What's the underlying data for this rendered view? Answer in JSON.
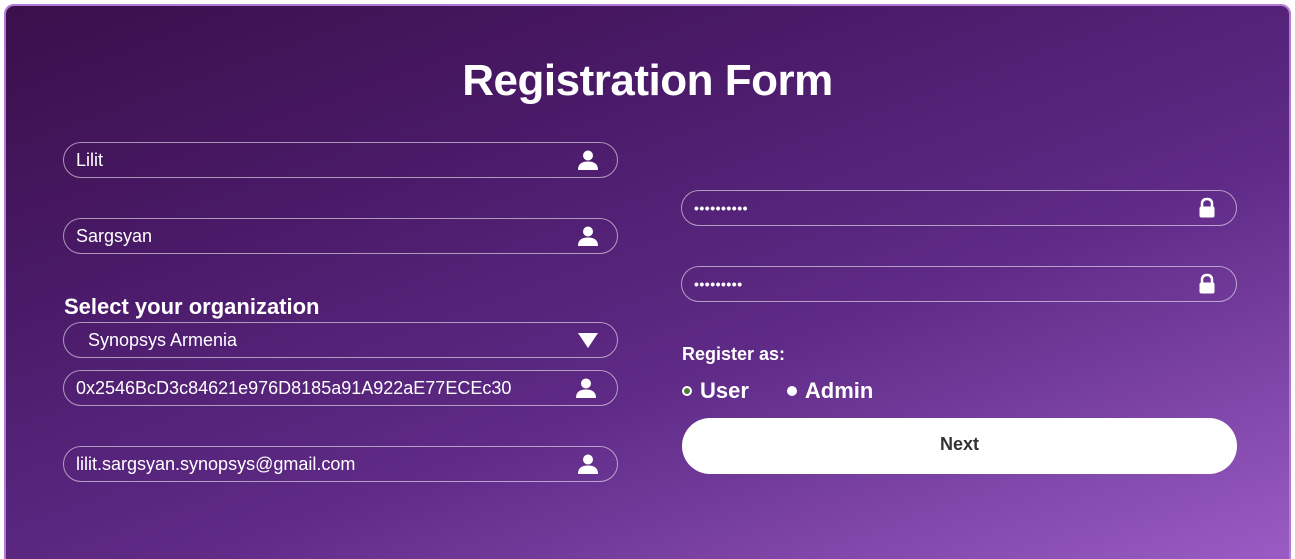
{
  "form": {
    "title": "Registration Form",
    "first_name": {
      "value": "Lilit",
      "icon": "user-icon"
    },
    "last_name": {
      "value": "Sargsyan",
      "icon": "user-icon"
    },
    "organization": {
      "label": "Select your organization",
      "selected": "Synopsys Armenia",
      "icon": "caret-down-icon"
    },
    "wallet_address": {
      "value": "0x2546BcD3c84621e976D8185a91A922aE77ECEc30",
      "icon": "user-icon"
    },
    "email": {
      "value": "lilit.sargsyan.synopsys@gmail.com",
      "icon": "user-icon"
    },
    "password": {
      "masked": "••••••••••",
      "icon": "lock-icon"
    },
    "confirm_password": {
      "masked": "•••••••••",
      "icon": "lock-icon"
    },
    "register_as": {
      "label": "Register as:",
      "options": [
        "User",
        "Admin"
      ],
      "selected": "User"
    },
    "next_label": "Next"
  },
  "colors": {
    "background_start": "#3a0f4a",
    "background_end": "#9a5cc4",
    "text": "#ffffff",
    "button_bg": "#ffffff",
    "button_text": "#333333"
  }
}
